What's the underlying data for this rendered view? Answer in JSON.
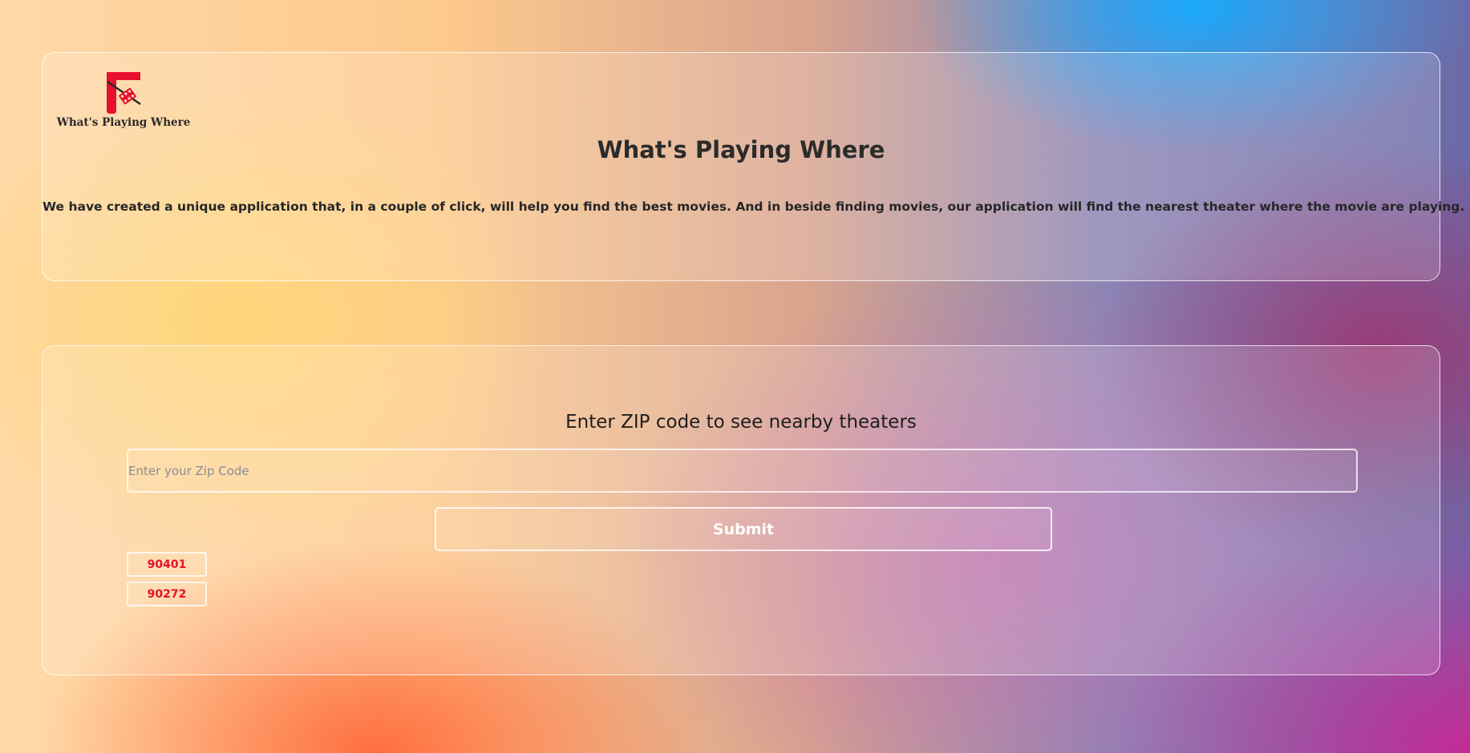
{
  "brand": {
    "logo_text": "What's Playing Where",
    "logo_color": "#e8102c"
  },
  "header": {
    "title": "What's Playing Where",
    "description": "We have created a unique application that, in a couple of click, will help you find the best movies. And in beside finding movies, our application will find the nearest theater where the movie are playing."
  },
  "zip_search": {
    "heading": "Enter ZIP code to see nearby theaters",
    "input_placeholder": "Enter your Zip Code",
    "input_value": "",
    "submit_label": "Submit",
    "recent_zips": [
      "90401",
      "90272"
    ],
    "recent_zip_color": "#e8102c"
  }
}
